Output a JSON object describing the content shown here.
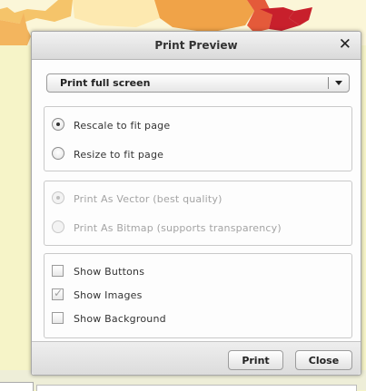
{
  "dialog": {
    "title": "Print Preview",
    "close_glyph": "✕"
  },
  "select": {
    "value": "Print full screen",
    "arrow_icon": "chevron-down-icon"
  },
  "scaling": {
    "options": [
      {
        "label": "Rescale to fit page",
        "checked": true,
        "enabled": true
      },
      {
        "label": "Resize to fit page",
        "checked": false,
        "enabled": true
      }
    ]
  },
  "format": {
    "options": [
      {
        "label": "Print As Vector (best quality)",
        "checked": true,
        "enabled": false
      },
      {
        "label": "Print As Bitmap (supports transparency)",
        "checked": false,
        "enabled": false
      }
    ]
  },
  "content": {
    "options": [
      {
        "label": "Show Buttons",
        "checked": false
      },
      {
        "label": "Show Images",
        "checked": true
      },
      {
        "label": "Show Background",
        "checked": false
      }
    ]
  },
  "buttons": {
    "print": "Print",
    "close": "Close"
  },
  "colors": {
    "page_background": "#f6f4c8",
    "map_orange": "#f4a94a",
    "map_red": "#c8202c"
  }
}
